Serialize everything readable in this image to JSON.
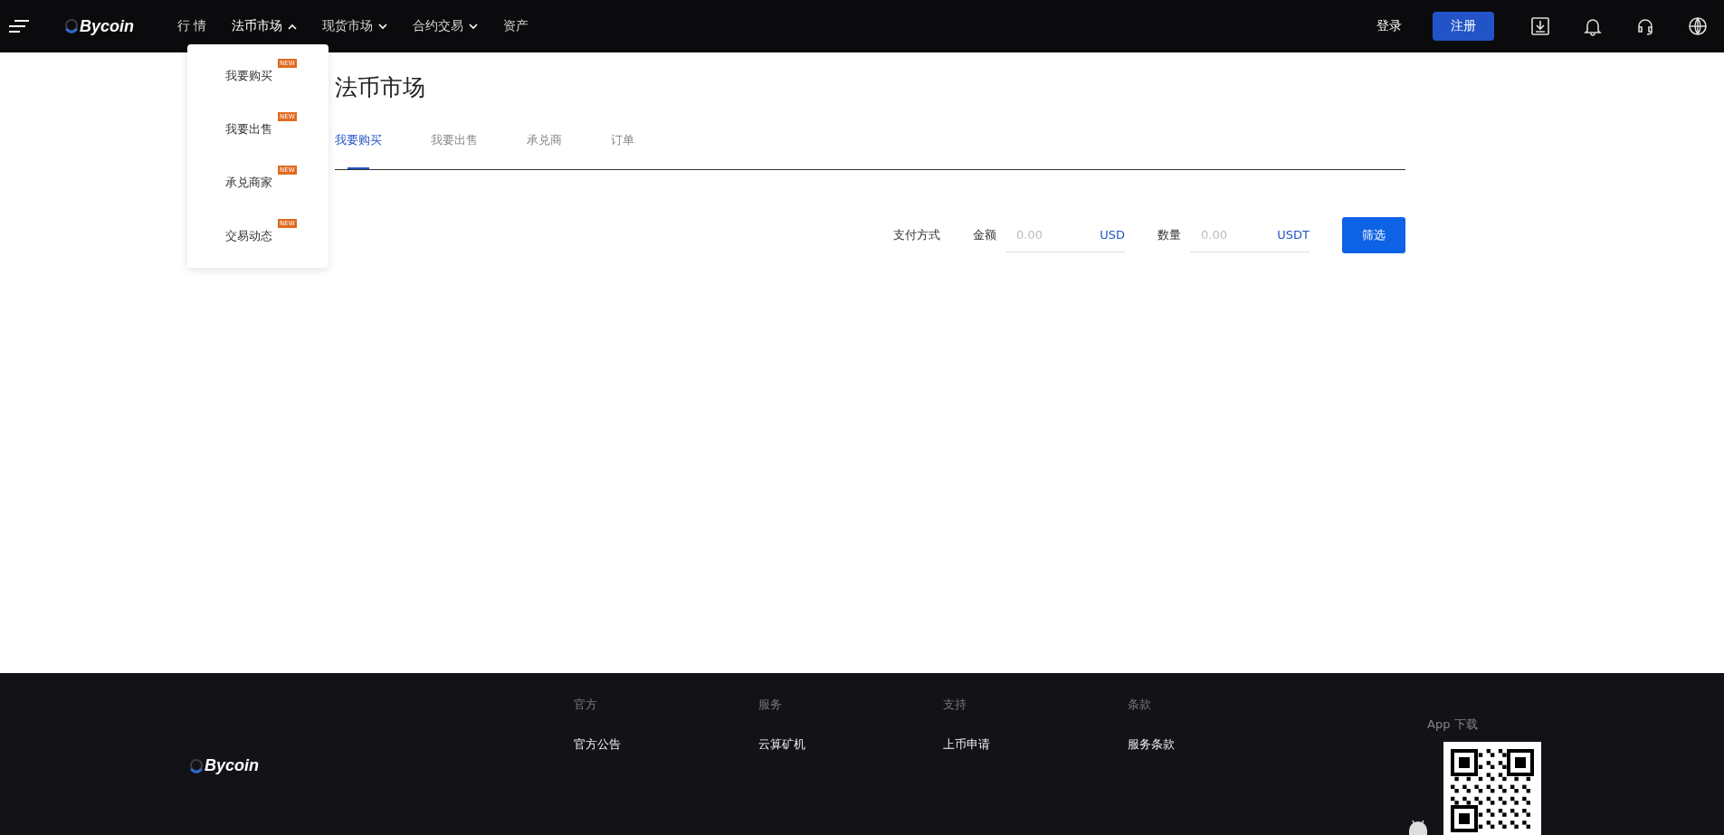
{
  "header": {
    "logo": "Bycoin",
    "nav": [
      {
        "label": "行 情",
        "selected": false
      },
      {
        "label": "法币市场",
        "expanded": true,
        "selected": true
      },
      {
        "label": "现货市场",
        "expanded": false,
        "selected": false
      },
      {
        "label": "合约交易",
        "expanded": false,
        "selected": false
      },
      {
        "label": "资产",
        "selected": false
      }
    ],
    "login": "登录",
    "register": "注册"
  },
  "dropdown": {
    "items": [
      {
        "label": "我要购买",
        "badge": "NEW"
      },
      {
        "label": "我要出售",
        "badge": "NEW"
      },
      {
        "label": "承兑商家",
        "badge": "NEW"
      },
      {
        "label": "交易动态",
        "badge": "NEW"
      }
    ]
  },
  "page": {
    "title": "法币市场",
    "tabs": [
      {
        "label": "我要购买",
        "selected": true
      },
      {
        "label": "我要出售",
        "selected": false
      },
      {
        "label": "承兑商",
        "selected": false
      },
      {
        "label": "订单",
        "selected": false
      }
    ],
    "filter": {
      "payment_label": "支付方式",
      "amount_label": "金额",
      "amount_placeholder": "0.00",
      "amount_unit": "USD",
      "quantity_label": "数量",
      "quantity_placeholder": "0.00",
      "quantity_unit": "USDT",
      "button": "筛选"
    }
  },
  "footer": {
    "logo": "Bycoin",
    "columns": [
      {
        "heading": "官方",
        "link": "官方公告"
      },
      {
        "heading": "服务",
        "link": "云算矿机"
      },
      {
        "heading": "支持",
        "link": "上币申请"
      },
      {
        "heading": "条款",
        "link": "服务条款"
      }
    ],
    "app_download": "App 下载"
  }
}
